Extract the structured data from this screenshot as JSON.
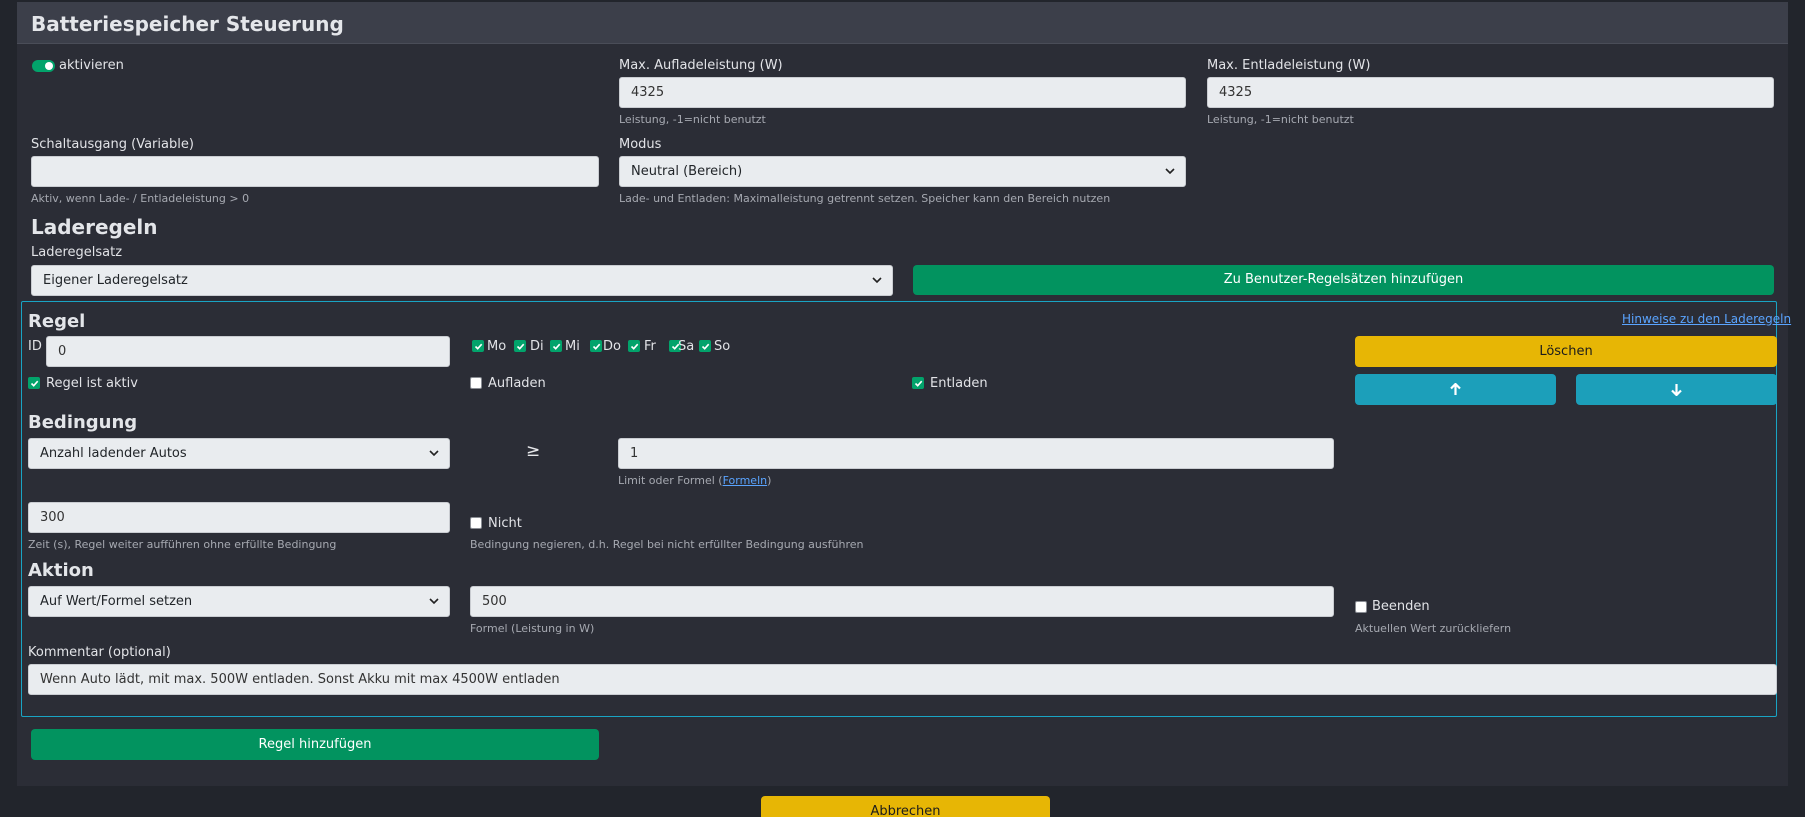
{
  "panel": {
    "title": "Batteriespeicher Steuerung"
  },
  "general": {
    "activate_label": "aktivieren",
    "max_charge": {
      "label": "Max. Aufladeleistung (W)",
      "value": "4325",
      "help": "Leistung, -1=nicht benutzt"
    },
    "max_discharge": {
      "label": "Max. Entladeleistung (W)",
      "value": "4325",
      "help": "Leistung, -1=nicht benutzt"
    },
    "switch_output": {
      "label": "Schaltausgang (Variable)",
      "value": "",
      "help": "Aktiv, wenn Lade- / Entladeleistung > 0"
    },
    "mode": {
      "label": "Modus",
      "value": "Neutral (Bereich)",
      "help": "Lade- und Entladen: Maximalleistung getrennt setzen. Speicher kann den Bereich nutzen"
    }
  },
  "charge_rules": {
    "heading": "Laderegeln",
    "ruleset_label": "Laderegelsatz",
    "ruleset_value": "Eigener Laderegelsatz",
    "add_to_user_sets_label": "Zu Benutzer-Regelsätzen hinzufügen"
  },
  "rule": {
    "heading": "Regel",
    "hints_link": "Hinweise zu den Laderegeln",
    "id_label": "ID",
    "id_value": "0",
    "days": [
      {
        "label": "Mo",
        "checked": true
      },
      {
        "label": "Di",
        "checked": true
      },
      {
        "label": "Mi",
        "checked": true
      },
      {
        "label": "Do",
        "checked": true
      },
      {
        "label": "Fr",
        "checked": true
      },
      {
        "label": "Sa",
        "checked": true
      },
      {
        "label": "So",
        "checked": true
      }
    ],
    "delete_label": "Löschen",
    "active_label": "Regel ist aktiv",
    "charge_label": "Aufladen",
    "discharge_label": "Entladen",
    "condition": {
      "heading": "Bedingung",
      "select_value": "Anzahl ladender Autos",
      "operator": "≥",
      "limit_value": "1",
      "limit_help_prefix": "Limit oder Formel (",
      "limit_help_link": "Formeln",
      "limit_help_suffix": ")",
      "time_value": "300",
      "time_help": "Zeit (s), Regel weiter aufführen ohne erfüllte Bedingung",
      "not_label": "Nicht",
      "not_help": "Bedingung negieren, d.h. Regel bei nicht erfüllter Bedingung ausführen"
    },
    "action": {
      "heading": "Aktion",
      "select_value": "Auf Wert/Formel setzen",
      "formula_value": "500",
      "formula_help": "Formel (Leistung in W)",
      "end_label": "Beenden",
      "end_help": "Aktuellen Wert zurückliefern"
    },
    "comment": {
      "label": "Kommentar (optional)",
      "value": "Wenn Auto lädt, mit max. 500W entladen. Sonst Akku mit max 4500W entladen"
    }
  },
  "add_rule_label": "Regel hinzufügen",
  "cancel_label": "Abbrechen",
  "colors": {
    "green": "#02935f",
    "yellow": "#e7b605",
    "cyan": "#1c9fba",
    "border_cyan": "#19a4c4"
  }
}
